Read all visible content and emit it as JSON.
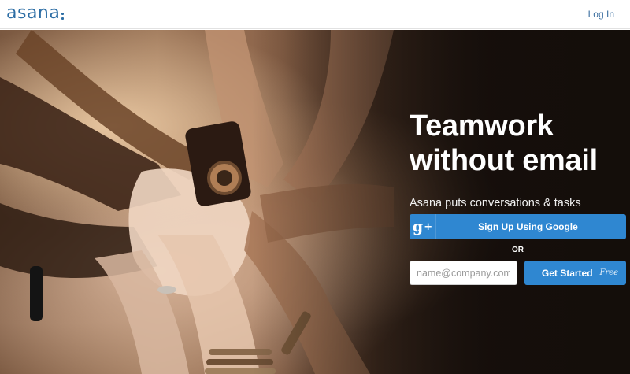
{
  "header": {
    "logo_text": "asana",
    "login_label": "Log In"
  },
  "hero": {
    "image_subject": "group of hands stacked together",
    "headline_line1": "Teamwork",
    "headline_line2": "without email",
    "subtext": "Asana puts conversations & tasks together, so you can get more done with less effort."
  },
  "signup": {
    "google_icon_text": "g+",
    "google_label": "Sign Up Using Google",
    "or_text": "OR",
    "email_placeholder": "name@company.com",
    "get_started_label": "Get Started",
    "free_label": "Free"
  },
  "colors": {
    "brand_blue": "#2d6ea5",
    "button_blue": "#2f87d1"
  }
}
